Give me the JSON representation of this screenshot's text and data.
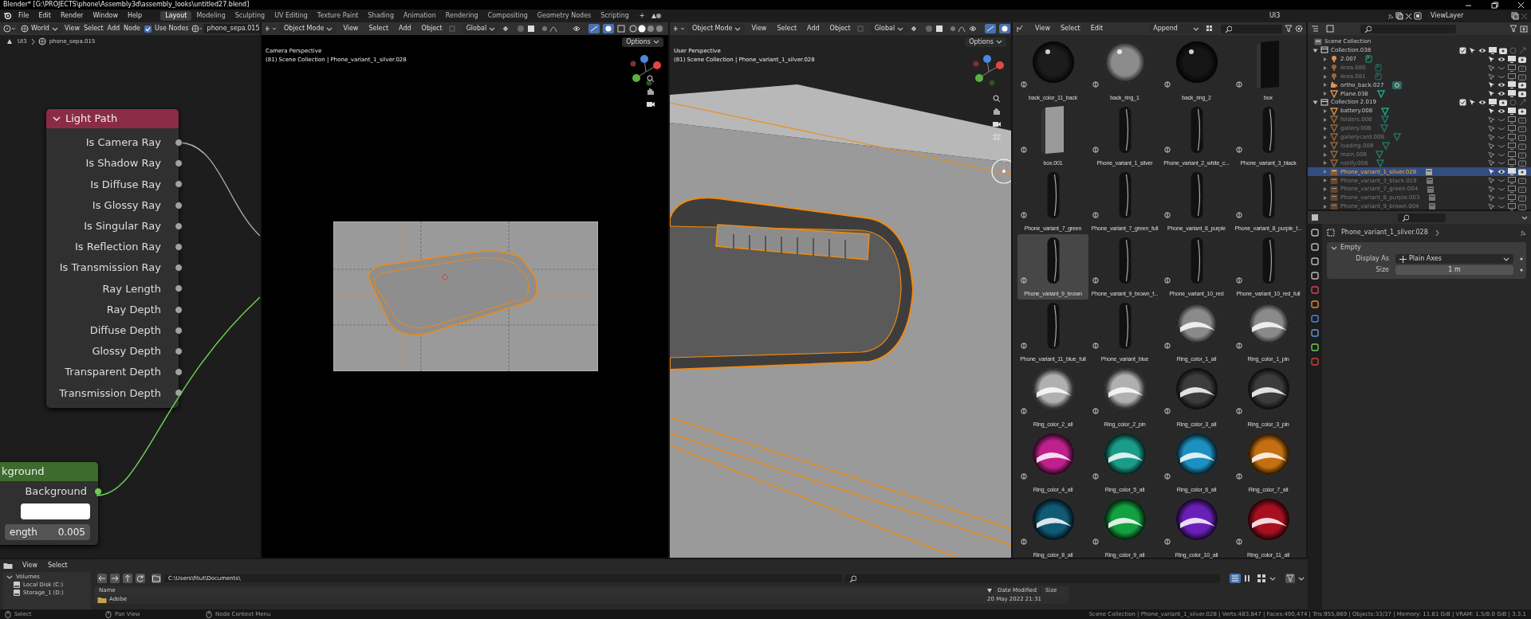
{
  "title_bar": {
    "title": "Blender* [G:\\PROJECTS\\phone\\Assembly3d\\assembly_looks\\untitled27.blend]"
  },
  "menu": [
    "File",
    "Edit",
    "Render",
    "Window",
    "Help"
  ],
  "workspaces": [
    {
      "label": "Layout",
      "selected": true
    },
    {
      "label": "Modeling",
      "selected": false
    },
    {
      "label": "Sculpting",
      "selected": false
    },
    {
      "label": "UV Editing",
      "selected": false
    },
    {
      "label": "Texture Paint",
      "selected": false
    },
    {
      "label": "Shading",
      "selected": false
    },
    {
      "label": "Animation",
      "selected": false
    },
    {
      "label": "Rendering",
      "selected": false
    },
    {
      "label": "Compositing",
      "selected": false
    },
    {
      "label": "Geometry Nodes",
      "selected": false
    },
    {
      "label": "Scripting",
      "selected": false
    }
  ],
  "add_workspace": "+",
  "scene": {
    "name": "UI3"
  },
  "view_layer": {
    "name": "ViewLayer"
  },
  "node_editor": {
    "world_menu": "World",
    "menus": [
      "View",
      "Select",
      "Add",
      "Node"
    ],
    "use_nodes": {
      "label": "Use Nodes",
      "checked": true
    },
    "world_name": "phone_sepa.015",
    "breadcrumb": [
      "UI3",
      "phone_sepa.015"
    ],
    "light_path": {
      "title": "Light Path",
      "expanded": true,
      "outputs": [
        "Is Camera Ray",
        "Is Shadow Ray",
        "Is Diffuse Ray",
        "Is Glossy Ray",
        "Is Singular Ray",
        "Is Reflection Ray",
        "Is Transmission Ray",
        "Ray Length",
        "Ray Depth",
        "Diffuse Depth",
        "Glossy Depth",
        "Transparent Depth",
        "Transmission Depth"
      ]
    },
    "background_node": {
      "title": "kground",
      "output": "Background",
      "field_label": "ength",
      "field_value": "0.005"
    }
  },
  "viewports": [
    {
      "kind": "camera",
      "mode": "Object Mode",
      "menus": [
        "View",
        "Select",
        "Add",
        "Object"
      ],
      "orientation": "Global",
      "options": "Options",
      "perspective": "Camera Perspective",
      "info": "(81) Scene Collection | Phone_variant_1_silver.028"
    },
    {
      "kind": "user",
      "mode": "Object Mode",
      "menus": [
        "View",
        "Select",
        "Add",
        "Object"
      ],
      "orientation": "Global",
      "options": "Options",
      "perspective": "User Perspective",
      "info": "(81) Scene Collection | Phone_variant_1_silver.028"
    }
  ],
  "asset_browser": {
    "menus": [
      "View",
      "Select",
      "Edit"
    ],
    "import_method": "Append",
    "assets": [
      {
        "name": "back_color_11_back",
        "kind": "sphere",
        "color": "#1c1c1c",
        "selected": false
      },
      {
        "name": "back_ring_1",
        "kind": "sphere",
        "color": "#8c8c8c",
        "selected": false
      },
      {
        "name": "back_ring_2",
        "kind": "sphere",
        "color": "#151515",
        "selected": false
      },
      {
        "name": "box",
        "kind": "box",
        "color": "#0e0e0e",
        "selected": false
      },
      {
        "name": "box.001",
        "kind": "box",
        "color": "#9a9a9a",
        "selected": false
      },
      {
        "name": "Phone_variant_1_silver",
        "kind": "phone",
        "selected": false
      },
      {
        "name": "Phone_variant_2_white_c...",
        "kind": "phone",
        "selected": false
      },
      {
        "name": "Phone_variant_3_black",
        "kind": "phone",
        "selected": false
      },
      {
        "name": "Phone_variant_7_green",
        "kind": "phone",
        "selected": false
      },
      {
        "name": "Phone_variant_7_green_full",
        "kind": "phone",
        "selected": false
      },
      {
        "name": "Phone_variant_8_purple",
        "kind": "phone",
        "selected": false
      },
      {
        "name": "Phone_variant_8_purple_f...",
        "kind": "phone",
        "selected": false
      },
      {
        "name": "Phone_variant_9_brown",
        "kind": "phone",
        "selected": true
      },
      {
        "name": "Phone_variant_9_brown_f...",
        "kind": "phone",
        "selected": false
      },
      {
        "name": "Phone_variant_10_red",
        "kind": "phone",
        "selected": false
      },
      {
        "name": "Phone_variant_10_red_full",
        "kind": "phone",
        "selected": false
      },
      {
        "name": "Phone_variant_11_blue_full",
        "kind": "phone",
        "selected": false
      },
      {
        "name": "Phone_variant_blue",
        "kind": "phone",
        "selected": false
      },
      {
        "name": "Ring_color_1_all",
        "kind": "ring",
        "color": "#8a8a8a",
        "selected": false
      },
      {
        "name": "Ring_color_1_pin",
        "kind": "ring",
        "color": "#8a8a8a",
        "selected": false
      },
      {
        "name": "Ring_color_2_all",
        "kind": "ring",
        "color": "#b0b0b0",
        "selected": false
      },
      {
        "name": "Ring_color_2_pin",
        "kind": "ring",
        "color": "#b0b0b0",
        "selected": false
      },
      {
        "name": "Ring_color_3_all",
        "kind": "ring",
        "color": "#3c3c3c",
        "selected": false
      },
      {
        "name": "Ring_color_3_pin",
        "kind": "ring",
        "color": "#3c3c3c",
        "selected": false
      },
      {
        "name": "Ring_color_4_all",
        "kind": "ring",
        "color": "#c0208c",
        "selected": false
      },
      {
        "name": "Ring_color_5_all",
        "kind": "ring",
        "color": "#1a9c88",
        "selected": false
      },
      {
        "name": "Ring_color_6_all",
        "kind": "ring",
        "color": "#1c90c0",
        "selected": false
      },
      {
        "name": "Ring_color_7_all",
        "kind": "ring",
        "color": "#c47010",
        "selected": false
      },
      {
        "name": "Ring_color_8_all",
        "kind": "ring",
        "color": "#105a74",
        "selected": false
      },
      {
        "name": "Ring_color_9_all",
        "kind": "ring",
        "color": "#12a040",
        "selected": false
      },
      {
        "name": "Ring_color_10_all",
        "kind": "ring",
        "color": "#6a20b8",
        "selected": false
      },
      {
        "name": "Ring_color_11_all",
        "kind": "ring",
        "color": "#a81020",
        "selected": false
      }
    ]
  },
  "outliner": {
    "root": "Scene Collection",
    "items": [
      {
        "name": "Collection.038",
        "kind": "collection",
        "enabled": true,
        "selected": false,
        "children": [
          {
            "name": "2.007",
            "kind": "light",
            "enabled": true,
            "selected": false
          },
          {
            "name": "Area.080",
            "kind": "light",
            "enabled": false,
            "selected": false
          },
          {
            "name": "Area.081",
            "kind": "light",
            "enabled": false,
            "selected": false
          },
          {
            "name": "ortho_back.027",
            "kind": "camera",
            "enabled": true,
            "selected": false
          },
          {
            "name": "Plane.038",
            "kind": "mesh",
            "enabled": true,
            "selected": false
          }
        ]
      },
      {
        "name": "Collection 2.019",
        "kind": "collection",
        "enabled": true,
        "selected": false,
        "children": [
          {
            "name": "battery.008",
            "kind": "mesh",
            "enabled": true,
            "selected": false
          },
          {
            "name": "folders.008",
            "kind": "mesh",
            "enabled": false,
            "selected": false
          },
          {
            "name": "gallery.008",
            "kind": "mesh",
            "enabled": false,
            "selected": false
          },
          {
            "name": "gallerycard.008",
            "kind": "mesh",
            "enabled": false,
            "selected": false
          },
          {
            "name": "loading.008",
            "kind": "mesh",
            "enabled": false,
            "selected": false
          },
          {
            "name": "main.008",
            "kind": "mesh",
            "enabled": false,
            "selected": false
          },
          {
            "name": "notify.008",
            "kind": "mesh",
            "enabled": false,
            "selected": false
          },
          {
            "name": "Phone_variant_1_silver.028",
            "kind": "instance",
            "enabled": true,
            "selected": true
          },
          {
            "name": "Phone_variant_3_black.019",
            "kind": "instance",
            "enabled": false,
            "selected": false
          },
          {
            "name": "Phone_variant_7_green.004",
            "kind": "instance",
            "enabled": false,
            "selected": false
          },
          {
            "name": "Phone_variant_8_purple.003",
            "kind": "instance",
            "enabled": false,
            "selected": false
          },
          {
            "name": "Phone_variant_9_brown.004",
            "kind": "instance",
            "enabled": false,
            "selected": false
          }
        ]
      }
    ]
  },
  "properties": {
    "object": "Phone_variant_1_silver.028",
    "panel": {
      "title": "Empty",
      "expanded": true
    },
    "fields": [
      {
        "label": "Display As",
        "value": "Plain Axes",
        "kind": "menu"
      },
      {
        "label": "Size",
        "value": "1 m",
        "kind": "number"
      }
    ]
  },
  "file_browser": {
    "menus": [
      "View",
      "Select"
    ],
    "volumes": {
      "title": "Volumes",
      "items": [
        "Local Disk (C:)",
        "Storage_1 (D:)"
      ]
    },
    "path": "C:\\Users\\fitut\\Documents\\",
    "columns": [
      "Name",
      "Date Modified",
      "Size"
    ],
    "rows": [
      {
        "name": "Adobe",
        "date": "20 May 2022 21:31"
      }
    ]
  },
  "status_bar": {
    "hints": [
      "Select",
      "Pan View",
      "Node Context Menu"
    ],
    "stats": "Scene Collection | Phone_variant_1_silver.028 | Verts:483,847 | Faces:490,474 | Tris:955,869 | Objects:33/37 | Memory: 11.81 GiB | VRAM: 1.5/8.0 GiB | 3.3.1"
  }
}
